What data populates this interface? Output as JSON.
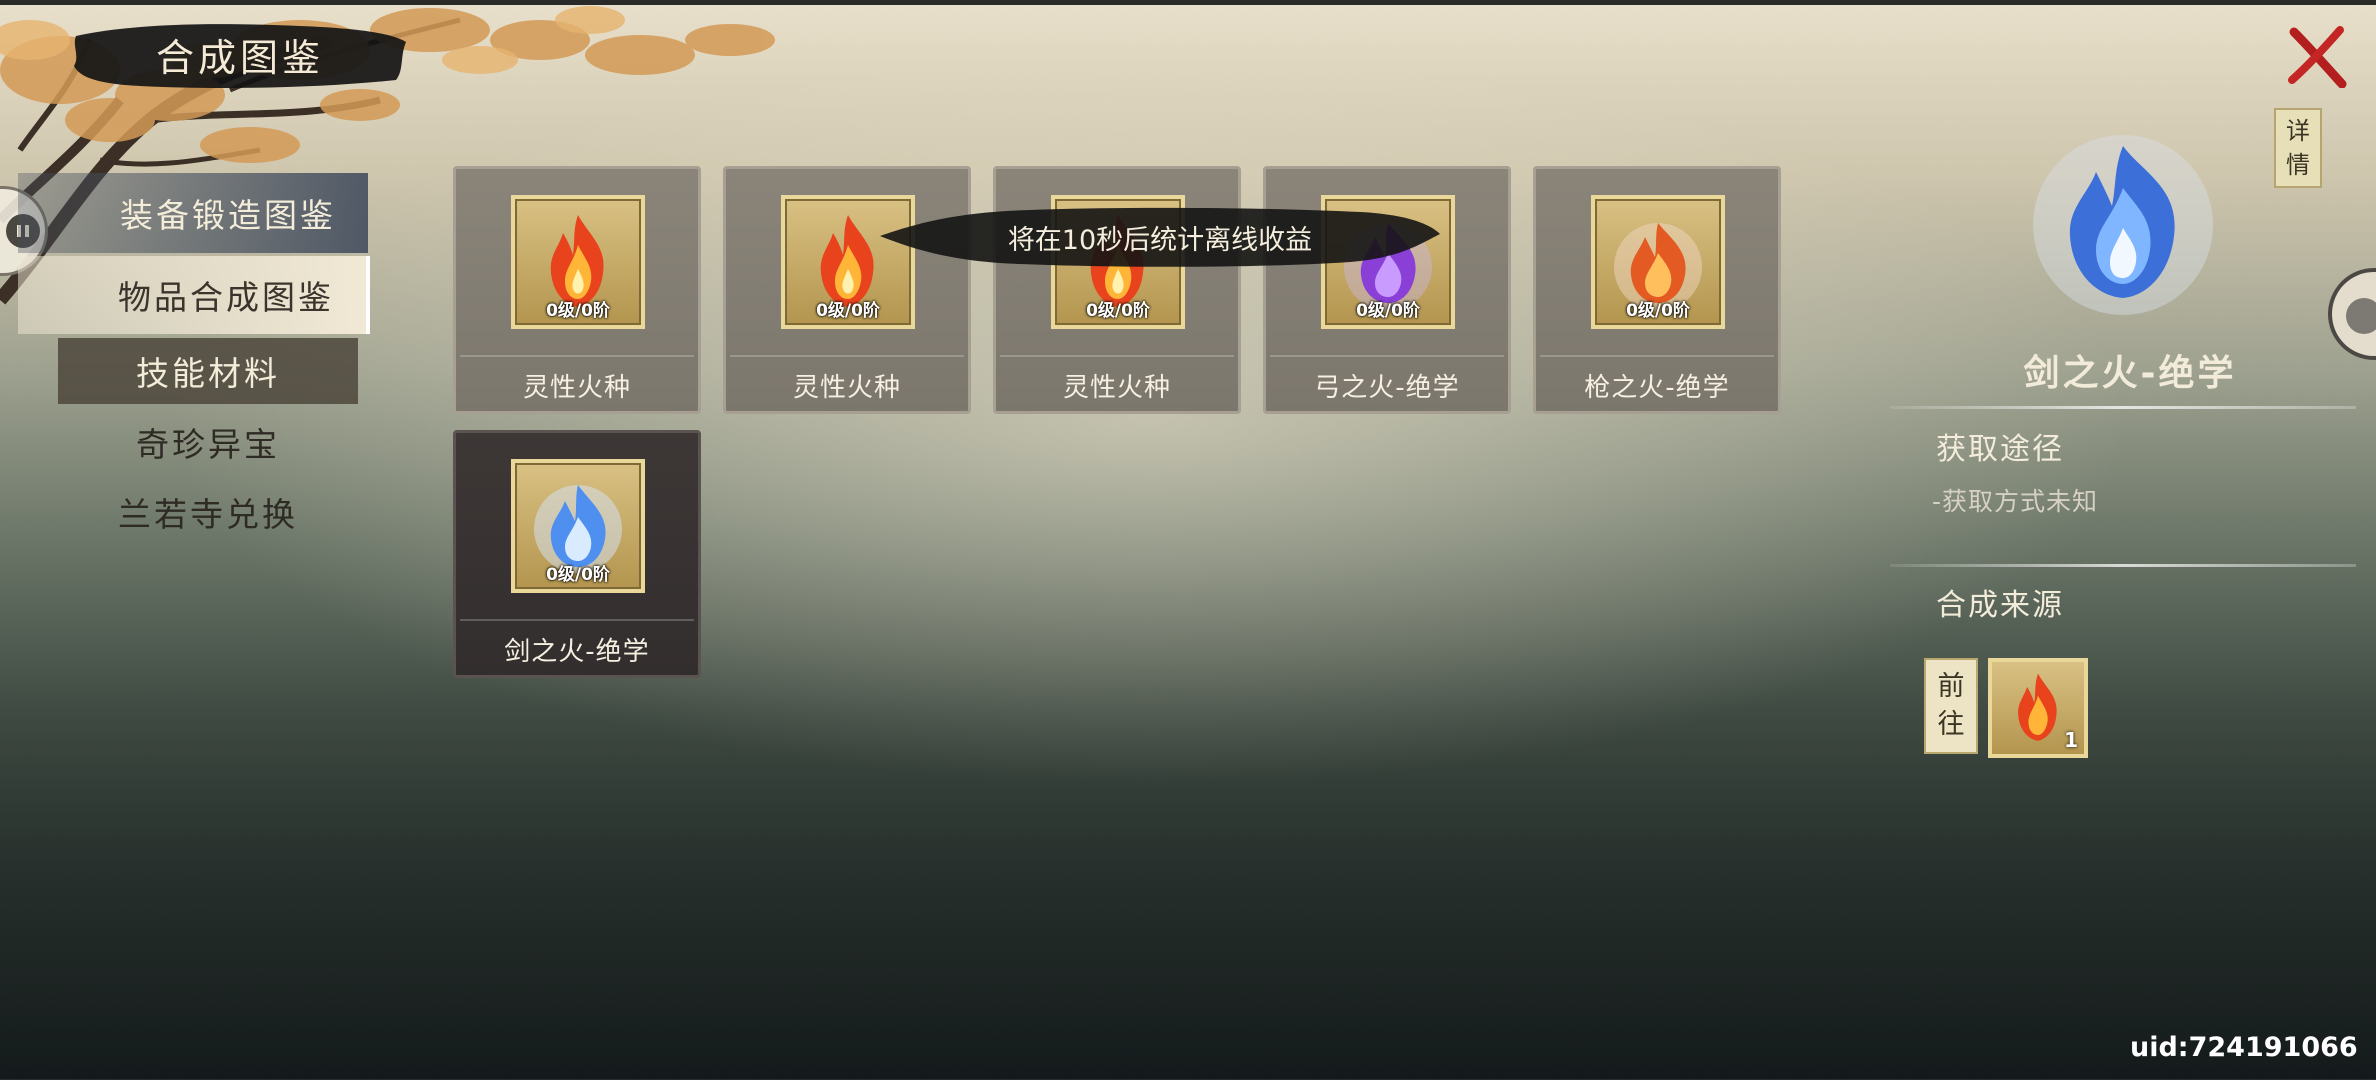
{
  "title": "合成图鉴",
  "nav": {
    "equipment": "装备锻造图鉴",
    "items": "物品合成图鉴",
    "skill_materials": "技能材料",
    "rare_treasures": "奇珍异宝",
    "lanruo_exchange": "兰若寺兑换"
  },
  "cards": [
    {
      "name": "灵性火种",
      "level": "0级/0阶",
      "icon": "red-flame-icon"
    },
    {
      "name": "灵性火种",
      "level": "0级/0阶",
      "icon": "red-flame-icon"
    },
    {
      "name": "灵性火种",
      "level": "0级/0阶",
      "icon": "red-flame-icon"
    },
    {
      "name": "弓之火-绝学",
      "level": "0级/0阶",
      "icon": "purple-flame-icon"
    },
    {
      "name": "枪之火-绝学",
      "level": "0级/0阶",
      "icon": "orange-flame-icon"
    },
    {
      "name": "剑之火-绝学",
      "level": "0级/0阶",
      "icon": "blue-flame-icon"
    }
  ],
  "toast": "将在10秒后统计离线收益",
  "detail": {
    "details_button": "详情",
    "name": "剑之火-绝学",
    "obtain_title": "获取途径",
    "obtain_text": "-获取方式未知",
    "source_title": "合成来源",
    "goto_button": "前往",
    "source_count": "1"
  },
  "uid": "uid:724191066",
  "colors": {
    "red_flame": "#e8431c",
    "blue_flame": "#4f8ff0",
    "purple_flame": "#8a3fd6",
    "frame_gold": "#ead79a",
    "selected_card": "#3d3736"
  }
}
